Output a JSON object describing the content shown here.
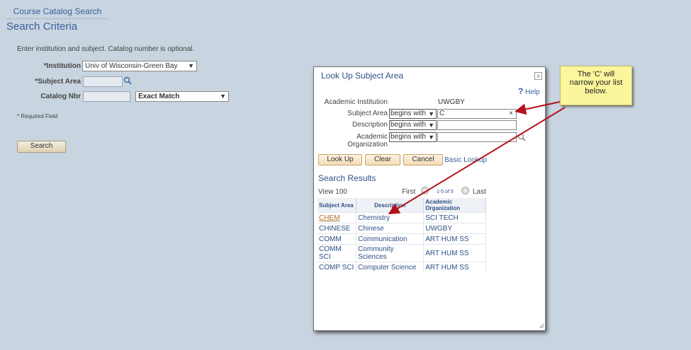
{
  "page": {
    "tab_label": "Course Catalog Search",
    "section_title": "Search Criteria",
    "instructions": "Enter institution and subject.  Catalog number is optional.",
    "institution_label": "*Institution",
    "institution_value": "Univ of Wisconsin-Green Bay",
    "subject_label": "*Subject Area",
    "catalog_label": "Catalog Nbr",
    "catalog_match_value": "Exact Match",
    "required_note": "* Required Field",
    "search_button": "Search"
  },
  "modal": {
    "title": "Look Up Subject Area",
    "close": "x",
    "help_icon": "?",
    "help_label": "Help",
    "institution_label": "Academic Institution",
    "institution_value": "UWGBY",
    "subject_label": "Subject Area",
    "subject_op": "begins with",
    "subject_value": "C",
    "subject_clear": "×",
    "description_label": "Description",
    "description_op": "begins with",
    "org_label": "Academic Organization",
    "org_op": "begins with",
    "buttons": {
      "lookup": "Look Up",
      "clear": "Clear",
      "cancel": "Cancel"
    },
    "basic_lookup": "Basic Lookup",
    "results_title": "Search Results",
    "view_all": "View 100",
    "first": "First",
    "range": "1-5 of 5",
    "last": "Last",
    "columns": [
      "Subject Area",
      "Description",
      "Academic Organization"
    ],
    "rows": [
      [
        "CHEM",
        "Chemistry",
        "SCI TECH"
      ],
      [
        "CHINESE",
        "Chinese",
        "UWGBY"
      ],
      [
        "COMM",
        "Communication",
        "ART HUM SS"
      ],
      [
        "COMM SCI",
        "Community Sciences",
        "ART HUM SS"
      ],
      [
        "COMP SCI",
        "Computer Science",
        "ART HUM SS"
      ]
    ]
  },
  "callout": {
    "line1": "The 'C' will",
    "line2": "narrow your list",
    "line3": "below."
  },
  "colors": {
    "arrow": "#b3121c",
    "callout_bg": "#fbf69d",
    "link": "#2f4f86",
    "page_bg": "#c8d4e0"
  }
}
